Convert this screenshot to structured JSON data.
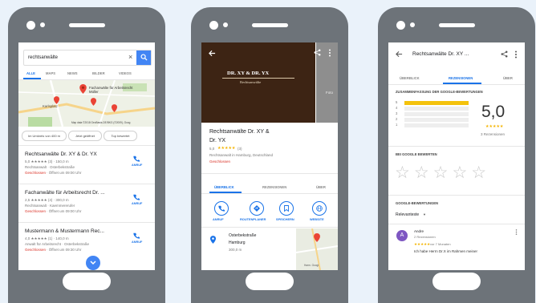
{
  "phone1": {
    "search_query": "rechtsanwälte",
    "tabs": [
      "ALLE",
      "MAPS",
      "NEWS",
      "BILDER",
      "VIDEOS"
    ],
    "map_label": "Fachanwälte für Arbeitsrecht Müller",
    "map_place": "Karlsplatz",
    "map_attribution": "Map data ©2018 GeoBasis-DE/BKG (©2009), Goog",
    "chips": [
      "Im Umkreis von 400 m",
      "Jetzt geöffnet",
      "Top bewertet"
    ],
    "results": [
      {
        "name": "Rechtsanwälte Dr. XY & Dr. YX",
        "rating_line": "5,0 ★★★★★ (3) · 150,0 m",
        "category": "Rechtsanwalt · Osterbekstraße",
        "status": "Geschlossen",
        "hours": "· Öffnet um 09:00 Uhr",
        "action": "ANRUF"
      },
      {
        "name": "Fachanwälte für Arbeitsrecht Dr. ...",
        "rating_line": "2,5 ★★★★★ (4) · 300,0 m",
        "category": "Rechtsanwalt · Kaemmererufer",
        "status": "Geschlossen",
        "hours": "· Öffnet um 09:00 Uhr",
        "action": "ANRUF"
      },
      {
        "name": "Mustermann & Mustermann Rec...",
        "rating_line": "4,0 ★★★★★ (1) · 140,0 m",
        "category": "Anwalt für Arbeitsrecht · Osterbekstraße",
        "status": "Geschlossen",
        "hours": "· Öffnet um 09:30 Uhr",
        "action": "ANRUF"
      }
    ]
  },
  "phone2": {
    "banner_title": "DR. XY & DR. YX",
    "banner_subtitle": "Rechtsanwälte",
    "side_label": "Foto",
    "title_line1": "Rechtsanwälte Dr. XY &",
    "title_line2": "Dr. YX",
    "rating_value": "5,0",
    "rating_count": "(3)",
    "subtitle": "Rechtsanwalt in Hamburg, Deutschland",
    "status": "Geschlossen",
    "tabs": [
      "ÜBERBLICK",
      "REZENSIONEN",
      "ÜBER"
    ],
    "actions": [
      "ANRUF",
      "ROUTENPLANER",
      "SPEICHERN",
      "WEBSITE"
    ],
    "address_line1": "Osterbekstraße",
    "address_line2": "Hamburg",
    "distance": "300,0 m",
    "map_attr": "Harm. Googl"
  },
  "phone3": {
    "title": "Rechtsanwälte Dr. XY ...",
    "tabs": [
      "ÜBERBLICK",
      "REZENSIONEN",
      "ÜBER"
    ],
    "summary_heading": "ZUSAMMENFASSUNG DER GOOGLE-BEWERTUNGEN",
    "bars": [
      {
        "label": "5",
        "fill": 1.0
      },
      {
        "label": "4",
        "fill": 0
      },
      {
        "label": "3",
        "fill": 0
      },
      {
        "label": "2",
        "fill": 0
      },
      {
        "label": "1",
        "fill": 0
      }
    ],
    "score": "5,0",
    "review_count": "3 Rezensionen",
    "rate_heading": "BEI GOOGLE BEWERTEN",
    "reviews_heading": "GOOGLE-BEWERTUNGEN",
    "sort_label": "Relevanteste",
    "reviewer_initial": "A",
    "reviewer_name": "Andre",
    "reviewer_meta": "2 Rezensionen",
    "review_time": "vor 7 Monaten",
    "review_snippet": "Ich habe Herrn Dr.X im Rahmen meiner"
  },
  "colors": {
    "phone": "#6d7379",
    "accent": "#1a73e8",
    "star": "#f4b400",
    "closed": "#d93025",
    "banner": "#3d2414",
    "bar": "#f4c20d"
  }
}
